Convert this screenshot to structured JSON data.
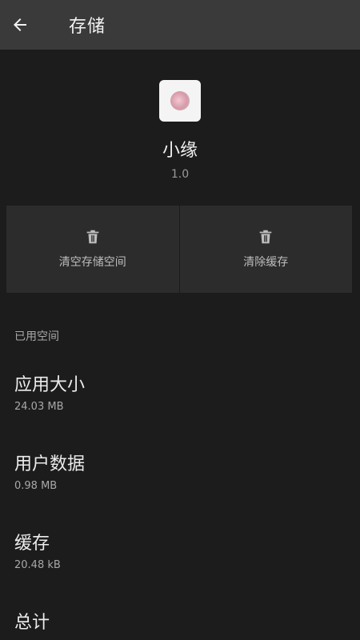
{
  "appbar": {
    "back_icon": "arrow-left-icon",
    "title": "存储"
  },
  "app": {
    "icon": "app-icon",
    "name": "小缘",
    "version": "1.0"
  },
  "actions": {
    "clear_storage_label": "清空存储空间",
    "clear_cache_label": "清除缓存",
    "icon": "trash-icon"
  },
  "used_space": {
    "section_title": "已用空间",
    "items": [
      {
        "label": "应用大小",
        "value": "24.03 MB"
      },
      {
        "label": "用户数据",
        "value": "0.98 MB"
      },
      {
        "label": "缓存",
        "value": "20.48 kB"
      },
      {
        "label": "总计",
        "value": ""
      }
    ]
  },
  "colors": {
    "background": "#1c1c1c",
    "appbar": "#3a3a3a",
    "button_bg": "#2c2c2c"
  }
}
